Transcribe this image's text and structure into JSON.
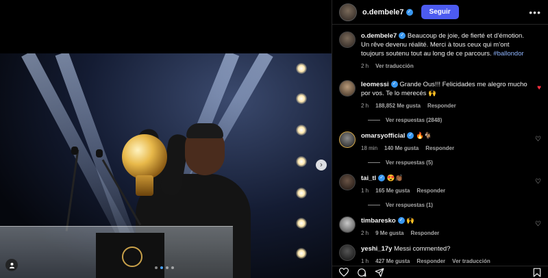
{
  "post": {
    "username": "o.dembele7",
    "follow_label": "Seguir",
    "more_icon": "more-horizontal-icon",
    "caption_text": "Beaucoup de joie, de fierté et d’émotion. Un rêve devenu réalité. Merci à tous ceux qui m’ont toujours soutenu tout au long de ce parcours.",
    "caption_hashtag": "#ballondor",
    "caption_time": "2 h",
    "caption_translate": "Ver traducción"
  },
  "media": {
    "next_icon": "chevron-right-icon",
    "tag_icon": "user-tag-icon",
    "dot_count": 4,
    "active_dot": 1
  },
  "comments": [
    {
      "user": "leomessi",
      "verified": true,
      "text": "Grande Ous!!! Felicidades me alegro mucho por vos. Te lo merecés 🙌",
      "time": "2 h",
      "likes": "188,852 Me gusta",
      "reply": "Responder",
      "replies": "Ver respuestas (2848)",
      "liked": true
    },
    {
      "user": "omarsyofficial",
      "verified": true,
      "text": "🔥🐐",
      "time": "18 min",
      "likes": "140 Me gusta",
      "reply": "Responder",
      "replies": "Ver respuestas (5)",
      "liked": false
    },
    {
      "user": "tai_tl",
      "verified": true,
      "text": "😍👏🏾",
      "time": "1 h",
      "likes": "165 Me gusta",
      "reply": "Responder",
      "replies": "Ver respuestas (1)",
      "liked": false
    },
    {
      "user": "timbaresko",
      "verified": true,
      "text": "🙌",
      "time": "2 h",
      "likes": "9 Me gusta",
      "reply": "Responder",
      "replies": "",
      "liked": false
    },
    {
      "user": "yeshi_17y",
      "verified": false,
      "text": "Messi commented?",
      "time": "1 h",
      "likes": "427 Me gusta",
      "reply": "Responder",
      "extra": "Ver traducción",
      "replies": "",
      "liked": false
    }
  ],
  "actions": {
    "like_icon": "heart-icon",
    "comment_icon": "comment-icon",
    "share_icon": "share-icon",
    "save_icon": "bookmark-icon"
  },
  "colors": {
    "accent": "#4c5bf0",
    "verified": "#3897f0",
    "liked": "#ff3040",
    "hashtag": "#8fb5ff"
  }
}
